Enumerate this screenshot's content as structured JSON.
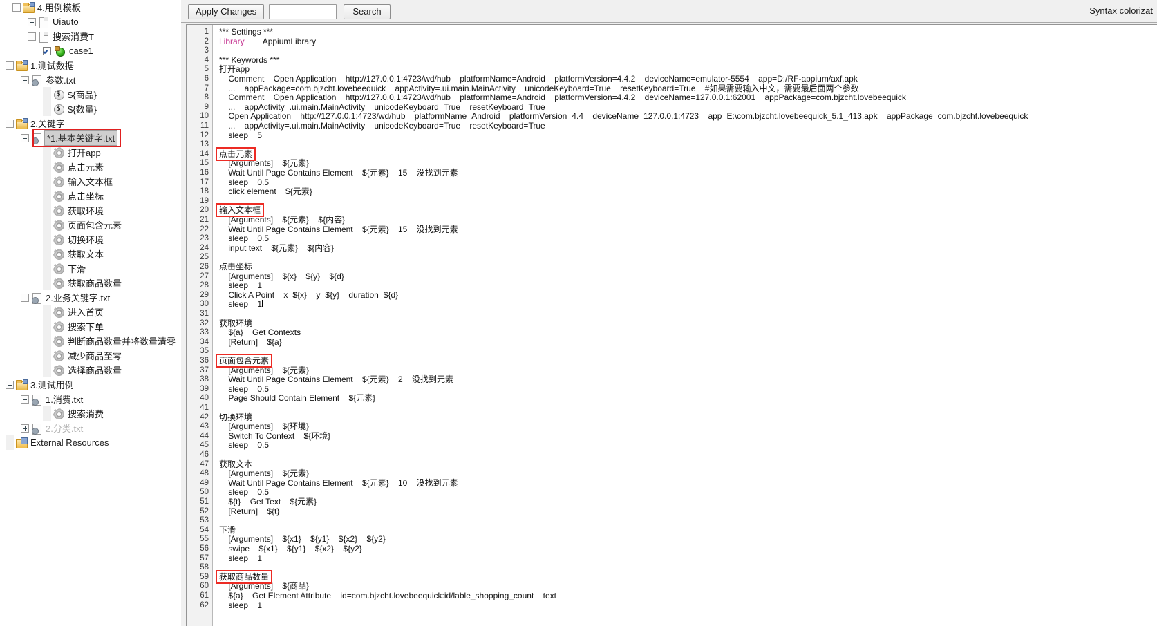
{
  "toolbar": {
    "apply_label": "Apply Changes",
    "search_label": "Search",
    "search_value": "",
    "search_placeholder": "",
    "syntax_label": "Syntax colorizat"
  },
  "tree": {
    "items": [
      {
        "label": "4.用例模板",
        "indent": 18,
        "icon": "folder-project",
        "twist": "minus",
        "dim": false,
        "selected": false
      },
      {
        "label": "Uiauto",
        "indent": 40,
        "icon": "file",
        "twist": "plus",
        "dim": false,
        "selected": false
      },
      {
        "label": "搜索消费T",
        "indent": 40,
        "icon": "file",
        "twist": "minus",
        "dim": false,
        "selected": false
      },
      {
        "label": "case1",
        "indent": 62,
        "icon": "case",
        "twist": "checkbox",
        "dim": false,
        "selected": false
      },
      {
        "label": "1.测试数据",
        "indent": 8,
        "icon": "folder-project",
        "twist": "minus",
        "dim": false,
        "selected": false
      },
      {
        "label": "参数.txt",
        "indent": 30,
        "icon": "txt",
        "twist": "minus",
        "dim": false,
        "selected": false
      },
      {
        "label": "${商品}",
        "indent": 62,
        "icon": "var",
        "twist": "none",
        "dim": false,
        "selected": false
      },
      {
        "label": "${数量}",
        "indent": 62,
        "icon": "var",
        "twist": "none",
        "dim": false,
        "selected": false
      },
      {
        "label": "2.关键字",
        "indent": 8,
        "icon": "folder-project",
        "twist": "minus",
        "dim": false,
        "selected": false
      },
      {
        "label": "*1.基本关键字.txt",
        "indent": 30,
        "icon": "txt",
        "twist": "minus",
        "dim": false,
        "selected": true
      },
      {
        "label": "打开app",
        "indent": 62,
        "icon": "gear",
        "twist": "none",
        "dim": false,
        "selected": false
      },
      {
        "label": "点击元素",
        "indent": 62,
        "icon": "gear",
        "twist": "none",
        "dim": false,
        "selected": false
      },
      {
        "label": "输入文本框",
        "indent": 62,
        "icon": "gear",
        "twist": "none",
        "dim": false,
        "selected": false
      },
      {
        "label": "点击坐标",
        "indent": 62,
        "icon": "gear",
        "twist": "none",
        "dim": false,
        "selected": false
      },
      {
        "label": "获取环境",
        "indent": 62,
        "icon": "gear",
        "twist": "none",
        "dim": false,
        "selected": false
      },
      {
        "label": "页面包含元素",
        "indent": 62,
        "icon": "gear",
        "twist": "none",
        "dim": false,
        "selected": false
      },
      {
        "label": "切换环境",
        "indent": 62,
        "icon": "gear",
        "twist": "none",
        "dim": false,
        "selected": false
      },
      {
        "label": "获取文本",
        "indent": 62,
        "icon": "gear",
        "twist": "none",
        "dim": false,
        "selected": false
      },
      {
        "label": "下滑",
        "indent": 62,
        "icon": "gear",
        "twist": "none",
        "dim": false,
        "selected": false
      },
      {
        "label": "获取商品数量",
        "indent": 62,
        "icon": "gear",
        "twist": "none",
        "dim": false,
        "selected": false
      },
      {
        "label": "2.业务关键字.txt",
        "indent": 30,
        "icon": "txt",
        "twist": "minus",
        "dim": false,
        "selected": false
      },
      {
        "label": "进入首页",
        "indent": 62,
        "icon": "gear",
        "twist": "none",
        "dim": false,
        "selected": false
      },
      {
        "label": "搜索下单",
        "indent": 62,
        "icon": "gear",
        "twist": "none",
        "dim": false,
        "selected": false
      },
      {
        "label": "判断商品数量并将数量清零",
        "indent": 62,
        "icon": "gear",
        "twist": "none",
        "dim": false,
        "selected": false
      },
      {
        "label": "减少商品至零",
        "indent": 62,
        "icon": "gear",
        "twist": "none",
        "dim": false,
        "selected": false
      },
      {
        "label": "选择商品数量",
        "indent": 62,
        "icon": "gear",
        "twist": "none",
        "dim": false,
        "selected": false
      },
      {
        "label": "3.测试用例",
        "indent": 8,
        "icon": "folder-project",
        "twist": "minus",
        "dim": false,
        "selected": false
      },
      {
        "label": "1.消费.txt",
        "indent": 30,
        "icon": "txt",
        "twist": "minus",
        "dim": false,
        "selected": false
      },
      {
        "label": "搜索消费",
        "indent": 62,
        "icon": "gear",
        "twist": "none",
        "dim": false,
        "selected": false
      },
      {
        "label": "2.分类.txt",
        "indent": 30,
        "icon": "txt",
        "twist": "plus",
        "dim": true,
        "selected": false
      },
      {
        "label": "External Resources",
        "indent": 8,
        "icon": "ext",
        "twist": "none",
        "dim": false,
        "selected": false
      }
    ]
  },
  "editor": {
    "first_line_number": 1,
    "lines": [
      "*** Settings ***",
      "Library        AppiumLibrary",
      "",
      "*** Keywords ***",
      "打开app",
      "    Comment    Open Application    http://127.0.0.1:4723/wd/hub    platformName=Android    platformVersion=4.4.2    deviceName=emulator-5554    app=D:/RF-appium/axf.apk",
      "    ...    appPackage=com.bjzcht.lovebeequick    appActivity=.ui.main.MainActivity    unicodeKeyboard=True    resetKeyboard=True    #如果需要输入中文，需要最后面两个参数",
      "    Comment    Open Application    http://127.0.0.1:4723/wd/hub    platformName=Android    platformVersion=4.4.2    deviceName=127.0.0.1:62001    appPackage=com.bjzcht.lovebeequick",
      "    ...    appActivity=.ui.main.MainActivity    unicodeKeyboard=True    resetKeyboard=True",
      "    Open Application    http://127.0.0.1:4723/wd/hub    platformName=Android    platformVersion=4.4    deviceName=127.0.0.1:4723    app=E:\\com.bjzcht.lovebeequick_5.1_413.apk    appPackage=com.bjzcht.lovebeequick",
      "    ...    appActivity=.ui.main.MainActivity    unicodeKeyboard=True    resetKeyboard=True",
      "    sleep    5",
      "",
      "点击元素",
      "    [Arguments]    ${元素}",
      "    Wait Until Page Contains Element    ${元素}    15    没找到元素",
      "    sleep    0.5",
      "    click element    ${元素}",
      "",
      "输入文本框",
      "    [Arguments]    ${元素}    ${内容}",
      "    Wait Until Page Contains Element    ${元素}    15    没找到元素",
      "    sleep    0.5",
      "    input text    ${元素}    ${内容}",
      "",
      "点击坐标",
      "    [Arguments]    ${x}    ${y}    ${d}",
      "    sleep    1",
      "    Click A Point    x=${x}    y=${y}    duration=${d}",
      "    sleep    1",
      "",
      "获取环境",
      "    ${a}    Get Contexts",
      "    [Return]    ${a}",
      "",
      "页面包含元素",
      "    [Arguments]    ${元素}",
      "    Wait Until Page Contains Element    ${元素}    2    没找到元素",
      "    sleep    0.5",
      "    Page Should Contain Element    ${元素}",
      "",
      "切换环境",
      "    [Arguments]    ${环境}",
      "    Switch To Context    ${环境}",
      "    sleep    0.5",
      "",
      "获取文本",
      "    [Arguments]    ${元素}",
      "    Wait Until Page Contains Element    ${元素}    10    没找到元素",
      "    sleep    0.5",
      "    ${t}    Get Text    ${元素}",
      "    [Return]    ${t}",
      "",
      "下滑",
      "    [Arguments]    ${x1}    ${y1}    ${x2}    ${y2}",
      "    swipe    ${x1}    ${y1}    ${x2}    ${y2}",
      "    sleep    1",
      "",
      "获取商品数量",
      "    [Arguments]    ${商品}",
      "    ${a}    Get Element Attribute    id=com.bjzcht.lovebeequick:id/lable_shopping_count    text",
      "    sleep    1"
    ],
    "highlight_color": "#ec2b24",
    "highlighted_keywords": [
      {
        "line": 14,
        "text": "点击元素"
      },
      {
        "line": 20,
        "text": "输入文本框"
      },
      {
        "line": 36,
        "text": "页面包含元素"
      },
      {
        "line": 59,
        "text": "获取商品数量"
      }
    ]
  }
}
